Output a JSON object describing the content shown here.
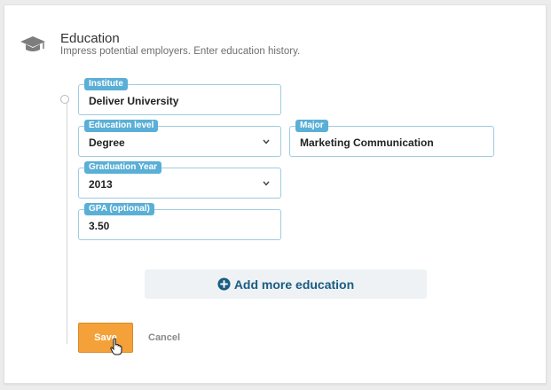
{
  "header": {
    "icon": "graduation-cap-icon",
    "title": "Education",
    "subtitle": "Impress potential employers. Enter education history."
  },
  "form": {
    "institute": {
      "label": "Institute",
      "value": "Deliver University"
    },
    "education_level": {
      "label": "Education level",
      "value": "Degree"
    },
    "major": {
      "label": "Major",
      "value": "Marketing Communication"
    },
    "graduation_year": {
      "label": "Graduation Year",
      "value": "2013"
    },
    "gpa": {
      "label": "GPA (optional)",
      "value": "3.50"
    }
  },
  "actions": {
    "add_more_label": "Add more education",
    "save_label": "Save",
    "cancel_label": "Cancel"
  },
  "colors": {
    "label_bg": "#5aafd6",
    "field_border": "#9fcbdf",
    "save_bg": "#f4a13a",
    "add_more_text": "#1a5c80"
  }
}
